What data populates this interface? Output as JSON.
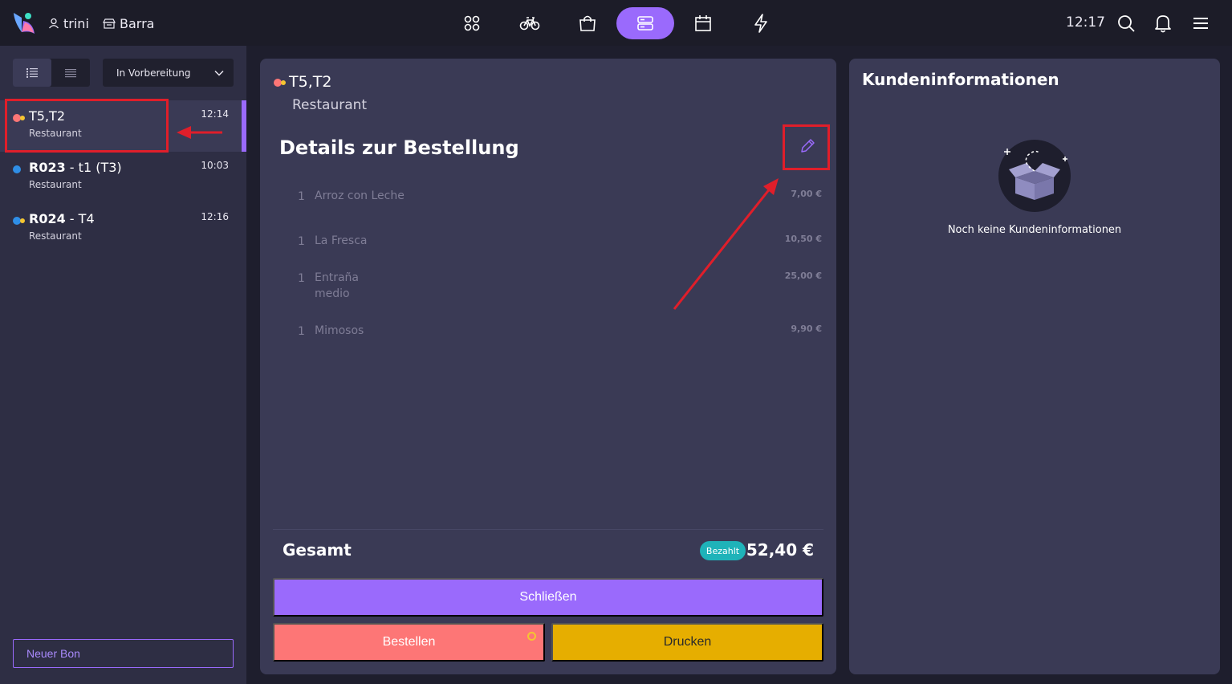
{
  "topbar": {
    "user_name": "trini",
    "site_name": "Barra",
    "time": "12:17",
    "nav_icons": [
      "grid-icon",
      "bike-icon",
      "shopping-bag-icon",
      "server-icon",
      "calendar-icon",
      "lightning-icon"
    ],
    "active_nav": "server-icon",
    "right_icons": [
      "search-icon",
      "bell-icon",
      "menu-icon"
    ]
  },
  "sidebar": {
    "status_filter": "In Vorbereitung",
    "orders": [
      {
        "title": "T5,T2",
        "title_bold": "",
        "title_rest": "T5,T2",
        "subtitle": "Restaurant",
        "time": "12:14",
        "selected": true
      },
      {
        "title": "R023 - t1 (T3)",
        "title_bold": "R023",
        "title_rest": " - t1 (T3)",
        "subtitle": "Restaurant",
        "time": "10:03",
        "selected": false
      },
      {
        "title": "R024 - T4",
        "title_bold": "R024",
        "title_rest": " - T4",
        "subtitle": "Restaurant",
        "time": "12:16",
        "selected": false
      }
    ],
    "new_bon_label": "Neuer Bon"
  },
  "order": {
    "title": "T5,T2",
    "subtitle": "Restaurant",
    "details_heading": "Details zur Bestellung",
    "items": [
      {
        "qty": "1",
        "name": "Arroz con Leche",
        "modifier": "",
        "price": "7,00 €"
      },
      {
        "qty": "1",
        "name": "La Fresca",
        "modifier": "",
        "price": "10,50 €"
      },
      {
        "qty": "1",
        "name": "Entraña",
        "modifier": "medio",
        "price": "25,00 €"
      },
      {
        "qty": "1",
        "name": "Mimosos",
        "modifier": "",
        "price": "9,90 €"
      }
    ],
    "total_label": "Gesamt",
    "paid_badge": "Bezahlt",
    "total_value": "52,40 €",
    "close_label": "Schließen",
    "order_label": "Bestellen",
    "print_label": "Drucken"
  },
  "customer": {
    "heading": "Kundeninformationen",
    "empty_text": "Noch keine Kundeninformationen"
  },
  "colors": {
    "accent": "#9a6afc",
    "order_button": "#fd7676",
    "print_button": "#e6ae00",
    "paid_badge": "#1fb3b9",
    "annotation": "#e01e2a"
  }
}
